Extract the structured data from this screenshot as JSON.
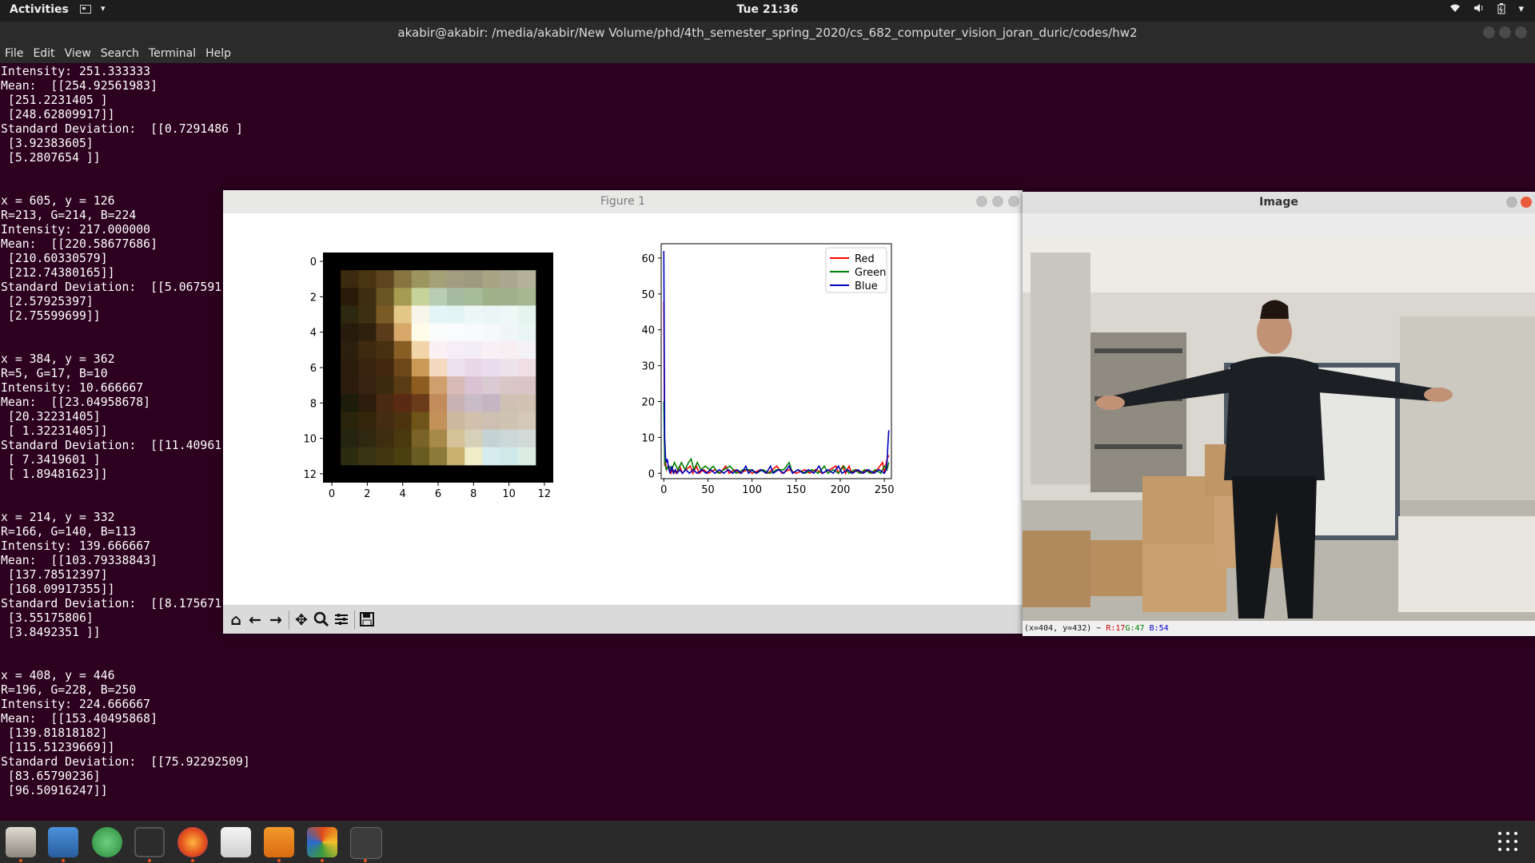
{
  "topbar": {
    "activities": "Activities",
    "clock": "Tue 21:36"
  },
  "terminal": {
    "title": "akabir@akabir: /media/akabir/New Volume/phd/4th_semester_spring_2020/cs_682_computer_vision_joran_duric/codes/hw2",
    "menu": [
      "File",
      "Edit",
      "View",
      "Search",
      "Terminal",
      "Help"
    ],
    "lines": [
      "Intensity: 251.333333",
      "Mean:  [[254.92561983]",
      " [251.2231405 ]",
      " [248.62809917]]",
      "Standard Deviation:  [[0.7291486 ]",
      " [3.92383605]",
      " [5.2807654 ]]",
      "",
      "",
      "x = 605, y = 126",
      "R=213, G=214, B=224",
      "Intensity: 217.000000",
      "Mean:  [[220.58677686]",
      " [210.60330579]",
      " [212.74380165]]",
      "Standard Deviation:  [[5.067591",
      " [2.57925397]",
      " [2.75599699]]",
      "",
      "",
      "x = 384, y = 362",
      "R=5, G=17, B=10",
      "Intensity: 10.666667",
      "Mean:  [[23.04958678]",
      " [20.32231405]",
      " [ 1.32231405]]",
      "Standard Deviation:  [[11.40961",
      " [ 7.3419601 ]",
      " [ 1.89481623]]",
      "",
      "",
      "x = 214, y = 332",
      "R=166, G=140, B=113",
      "Intensity: 139.666667",
      "Mean:  [[103.79338843]",
      " [137.78512397]",
      " [168.09917355]]",
      "Standard Deviation:  [[8.175671",
      " [3.55175806]",
      " [3.8492351 ]]",
      "",
      "",
      "x = 408, y = 446",
      "R=196, G=228, B=250",
      "Intensity: 224.666667",
      "Mean:  [[153.40495868]",
      " [139.81818182]",
      " [115.51239669]]",
      "Standard Deviation:  [[75.92292509]",
      " [83.65790236]",
      " [96.50916247]]"
    ]
  },
  "figure": {
    "title": "Figure 1",
    "heatmap": {
      "xticks": [
        "0",
        "2",
        "4",
        "6",
        "8",
        "10",
        "12"
      ],
      "yticks": [
        "0",
        "2",
        "4",
        "6",
        "8",
        "10",
        "12"
      ]
    },
    "toolbar_icons": [
      "home-icon",
      "back-arrow-icon",
      "forward-arrow-icon",
      "pan-icon",
      "zoom-icon",
      "configure-subplots-icon",
      "save-icon"
    ]
  },
  "chart_data": {
    "type": "line",
    "title": "",
    "xlabel": "",
    "ylabel": "",
    "xlim": [
      -3,
      258
    ],
    "ylim": [
      -1.5,
      64
    ],
    "xticks": [
      0,
      50,
      100,
      150,
      200,
      250
    ],
    "yticks": [
      0,
      10,
      20,
      30,
      40,
      50,
      60
    ],
    "legend_position": "top-right",
    "series": [
      {
        "name": "Red",
        "color": "#ff0000",
        "points": [
          [
            0,
            48
          ],
          [
            1,
            2
          ],
          [
            2,
            3
          ],
          [
            3,
            1
          ],
          [
            5,
            2
          ],
          [
            8,
            0
          ],
          [
            10,
            1
          ],
          [
            14,
            0
          ],
          [
            18,
            2
          ],
          [
            21,
            0
          ],
          [
            25,
            1
          ],
          [
            30,
            2
          ],
          [
            33,
            0
          ],
          [
            37,
            2
          ],
          [
            40,
            0
          ],
          [
            45,
            1
          ],
          [
            50,
            0
          ],
          [
            58,
            1
          ],
          [
            64,
            0
          ],
          [
            70,
            2
          ],
          [
            74,
            0
          ],
          [
            80,
            1
          ],
          [
            86,
            0
          ],
          [
            95,
            1
          ],
          [
            100,
            0
          ],
          [
            110,
            1
          ],
          [
            118,
            0
          ],
          [
            128,
            2
          ],
          [
            134,
            0
          ],
          [
            142,
            1
          ],
          [
            150,
            0
          ],
          [
            160,
            1
          ],
          [
            165,
            0
          ],
          [
            172,
            1
          ],
          [
            180,
            0
          ],
          [
            188,
            1
          ],
          [
            195,
            2
          ],
          [
            198,
            0
          ],
          [
            203,
            2
          ],
          [
            206,
            0
          ],
          [
            210,
            2
          ],
          [
            213,
            0
          ],
          [
            218,
            1
          ],
          [
            224,
            0
          ],
          [
            230,
            1
          ],
          [
            236,
            0
          ],
          [
            242,
            1
          ],
          [
            248,
            3
          ],
          [
            250,
            0
          ],
          [
            253,
            4
          ],
          [
            255,
            5
          ]
        ]
      },
      {
        "name": "Green",
        "color": "#008000",
        "points": [
          [
            0,
            20
          ],
          [
            1,
            3
          ],
          [
            3,
            1
          ],
          [
            6,
            2
          ],
          [
            9,
            1
          ],
          [
            12,
            3
          ],
          [
            16,
            1
          ],
          [
            20,
            3
          ],
          [
            24,
            1
          ],
          [
            28,
            3
          ],
          [
            31,
            4
          ],
          [
            34,
            1
          ],
          [
            38,
            3
          ],
          [
            42,
            1
          ],
          [
            47,
            2
          ],
          [
            52,
            1
          ],
          [
            56,
            2
          ],
          [
            62,
            0
          ],
          [
            68,
            1
          ],
          [
            75,
            2
          ],
          [
            82,
            0
          ],
          [
            90,
            1
          ],
          [
            98,
            1
          ],
          [
            105,
            0
          ],
          [
            112,
            1
          ],
          [
            120,
            0
          ],
          [
            128,
            1
          ],
          [
            136,
            1
          ],
          [
            142,
            3
          ],
          [
            146,
            0
          ],
          [
            152,
            1
          ],
          [
            160,
            0
          ],
          [
            168,
            1
          ],
          [
            175,
            0
          ],
          [
            182,
            2
          ],
          [
            186,
            0
          ],
          [
            192,
            1
          ],
          [
            198,
            0
          ],
          [
            204,
            2
          ],
          [
            210,
            0
          ],
          [
            216,
            1
          ],
          [
            222,
            0
          ],
          [
            228,
            1
          ],
          [
            234,
            0
          ],
          [
            240,
            1
          ],
          [
            246,
            0
          ],
          [
            250,
            2
          ],
          [
            253,
            1
          ],
          [
            255,
            3
          ]
        ]
      },
      {
        "name": "Blue",
        "color": "#0000bb",
        "points": [
          [
            0,
            62
          ],
          [
            1,
            10
          ],
          [
            2,
            4
          ],
          [
            3,
            3
          ],
          [
            4,
            4
          ],
          [
            5,
            2
          ],
          [
            7,
            0
          ],
          [
            9,
            2
          ],
          [
            11,
            0
          ],
          [
            13,
            1
          ],
          [
            15,
            0
          ],
          [
            18,
            1
          ],
          [
            21,
            0
          ],
          [
            25,
            1
          ],
          [
            29,
            0
          ],
          [
            33,
            1
          ],
          [
            38,
            0
          ],
          [
            43,
            1
          ],
          [
            48,
            0
          ],
          [
            53,
            1
          ],
          [
            58,
            0
          ],
          [
            63,
            1
          ],
          [
            68,
            0
          ],
          [
            73,
            1
          ],
          [
            78,
            0
          ],
          [
            83,
            1
          ],
          [
            88,
            0
          ],
          [
            93,
            2
          ],
          [
            96,
            0
          ],
          [
            100,
            1
          ],
          [
            105,
            0
          ],
          [
            110,
            1
          ],
          [
            116,
            0
          ],
          [
            121,
            2
          ],
          [
            124,
            0
          ],
          [
            130,
            1
          ],
          [
            136,
            0
          ],
          [
            142,
            2
          ],
          [
            146,
            0
          ],
          [
            152,
            1
          ],
          [
            158,
            0
          ],
          [
            164,
            1
          ],
          [
            170,
            0
          ],
          [
            176,
            2
          ],
          [
            180,
            0
          ],
          [
            186,
            1
          ],
          [
            192,
            0
          ],
          [
            198,
            2
          ],
          [
            202,
            0
          ],
          [
            208,
            1
          ],
          [
            214,
            0
          ],
          [
            220,
            1
          ],
          [
            226,
            0
          ],
          [
            232,
            1
          ],
          [
            238,
            0
          ],
          [
            244,
            1
          ],
          [
            250,
            0
          ],
          [
            252,
            1
          ],
          [
            253,
            3
          ],
          [
            254,
            8
          ],
          [
            255,
            12
          ]
        ]
      }
    ]
  },
  "image_window": {
    "title": "Image",
    "status_coords": "(x=404, y=432) ~ ",
    "status_r": "R:17",
    "status_g": "G:47",
    "status_b": "B:54"
  }
}
